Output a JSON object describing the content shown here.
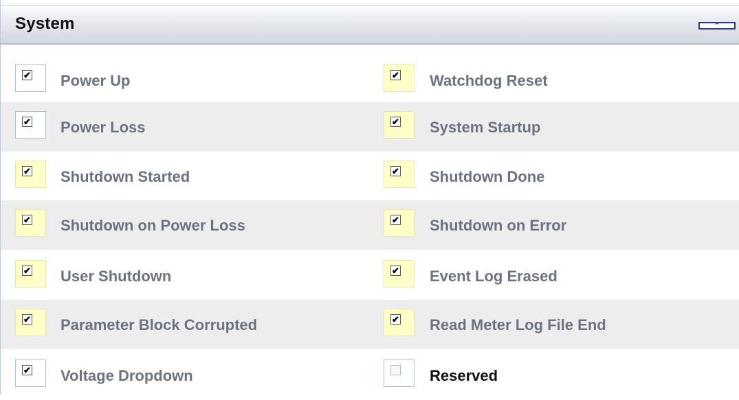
{
  "header": {
    "title": "System",
    "collapse_glyph": "⌃"
  },
  "rows": [
    {
      "left": {
        "label": "Power Up",
        "checked": true,
        "highlight": false
      },
      "right": {
        "label": "Watchdog Reset",
        "checked": true,
        "highlight": true
      }
    },
    {
      "left": {
        "label": "Power Loss",
        "checked": true,
        "highlight": false
      },
      "right": {
        "label": "System Startup",
        "checked": true,
        "highlight": true
      }
    },
    {
      "left": {
        "label": "Shutdown Started",
        "checked": true,
        "highlight": true
      },
      "right": {
        "label": "Shutdown Done",
        "checked": true,
        "highlight": true
      }
    },
    {
      "left": {
        "label": "Shutdown on Power Loss",
        "checked": true,
        "highlight": true
      },
      "right": {
        "label": "Shutdown on Error",
        "checked": true,
        "highlight": true
      }
    },
    {
      "left": {
        "label": "User Shutdown",
        "checked": true,
        "highlight": true
      },
      "right": {
        "label": "Event Log Erased",
        "checked": true,
        "highlight": true
      }
    },
    {
      "left": {
        "label": "Parameter Block Corrupted",
        "checked": true,
        "highlight": true
      },
      "right": {
        "label": "Read Meter Log File End",
        "checked": true,
        "highlight": true
      }
    },
    {
      "left": {
        "label": "Voltage Dropdown",
        "checked": true,
        "highlight": false
      },
      "right": {
        "label": "Reserved",
        "checked": false,
        "highlight": false
      }
    }
  ],
  "colors": {
    "label": "#6b7383",
    "label_unchecked": "#111111",
    "highlight": "#ffffc6",
    "row_alt": "#ededed"
  }
}
